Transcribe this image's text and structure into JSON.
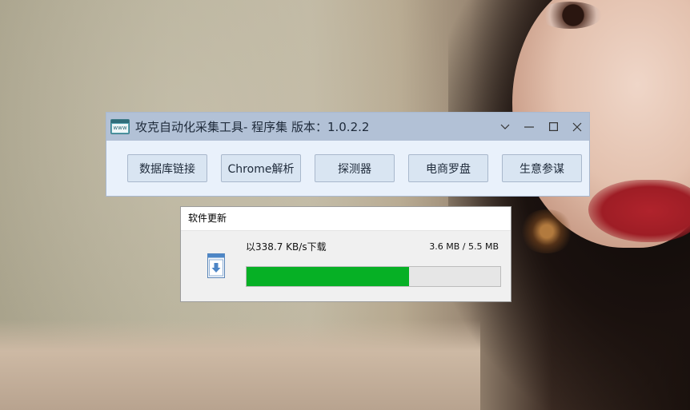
{
  "window": {
    "title": "攻克自动化采集工具- 程序集 版本：1.0.2.2",
    "app_icon_text": "www",
    "controls": {
      "collapse_icon": "chevron-down-icon",
      "minimize_icon": "minimize-icon",
      "maximize_icon": "maximize-icon",
      "close_icon": "close-icon"
    },
    "buttons": [
      {
        "label": "数据库链接"
      },
      {
        "label": "Chrome解析"
      },
      {
        "label": "探测器"
      },
      {
        "label": "电商罗盘"
      },
      {
        "label": "生意参谋"
      }
    ]
  },
  "update_dialog": {
    "title": "软件更新",
    "icon": "download-icon",
    "speed_text": "以338.7 KB/s下载",
    "size_text": "3.6 MB / 5.5 MB",
    "progress": 0.64,
    "progress_color": "#06b025"
  }
}
